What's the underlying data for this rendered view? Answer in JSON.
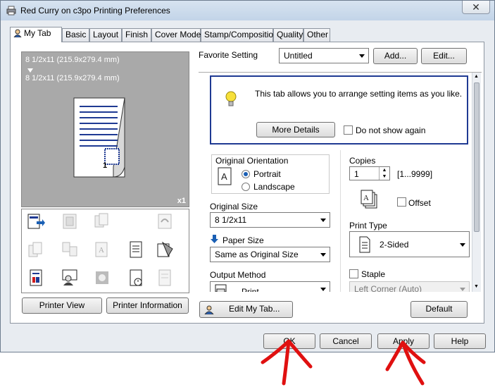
{
  "window": {
    "title": "Red Curry on c3po Printing Preferences",
    "close_glyph": "✕"
  },
  "tabs": [
    {
      "label": "My Tab",
      "active": true
    },
    {
      "label": "Basic"
    },
    {
      "label": "Layout"
    },
    {
      "label": "Finish"
    },
    {
      "label": "Cover Mode"
    },
    {
      "label": "Stamp/Composition"
    },
    {
      "label": "Quality"
    },
    {
      "label": "Other"
    }
  ],
  "preview": {
    "paper_line1": "8 1/2x11 (215.9x279.4 mm)",
    "paper_line2": "8 1/2x11 (215.9x279.4 mm)",
    "copies_badge": "x1",
    "page_number": "1"
  },
  "left_buttons": {
    "printer_view": "Printer View",
    "printer_information": "Printer Information"
  },
  "favorite": {
    "label": "Favorite Setting",
    "value": "Untitled",
    "add": "Add...",
    "edit": "Edit..."
  },
  "info": {
    "text": "This tab allows you to arrange setting items as you like.",
    "more_details": "More Details",
    "do_not_show": "Do not show again"
  },
  "orientation": {
    "label": "Original Orientation",
    "portrait": "Portrait",
    "landscape": "Landscape",
    "selected": "Portrait"
  },
  "original_size": {
    "label": "Original Size",
    "value": "8 1/2x11"
  },
  "paper_size": {
    "label": "Paper Size",
    "value": "Same as Original Size"
  },
  "output_method": {
    "label": "Output Method",
    "value": "Print"
  },
  "copies": {
    "label": "Copies",
    "value": "1",
    "range": "[1...9999]"
  },
  "offset": {
    "label": "Offset"
  },
  "print_type": {
    "label": "Print Type",
    "value": "2-Sided"
  },
  "staple": {
    "label": "Staple",
    "value": "Left Corner (Auto)"
  },
  "edit_my_tab": "Edit My Tab...",
  "default_btn": "Default",
  "dialog_buttons": {
    "ok": "OK",
    "cancel": "Cancel",
    "apply": "Apply",
    "help": "Help"
  },
  "colors": {
    "annotation_red": "#e01010",
    "focus_blue": "#1f3a93",
    "preview_gray": "#a9a9a9"
  },
  "icons": [
    "printer-icon",
    "lightbulb-icon",
    "portrait-icon",
    "collate-icon",
    "print-type-icon",
    "blue-arrow-icon",
    "output-method-icon",
    "user-icon"
  ]
}
